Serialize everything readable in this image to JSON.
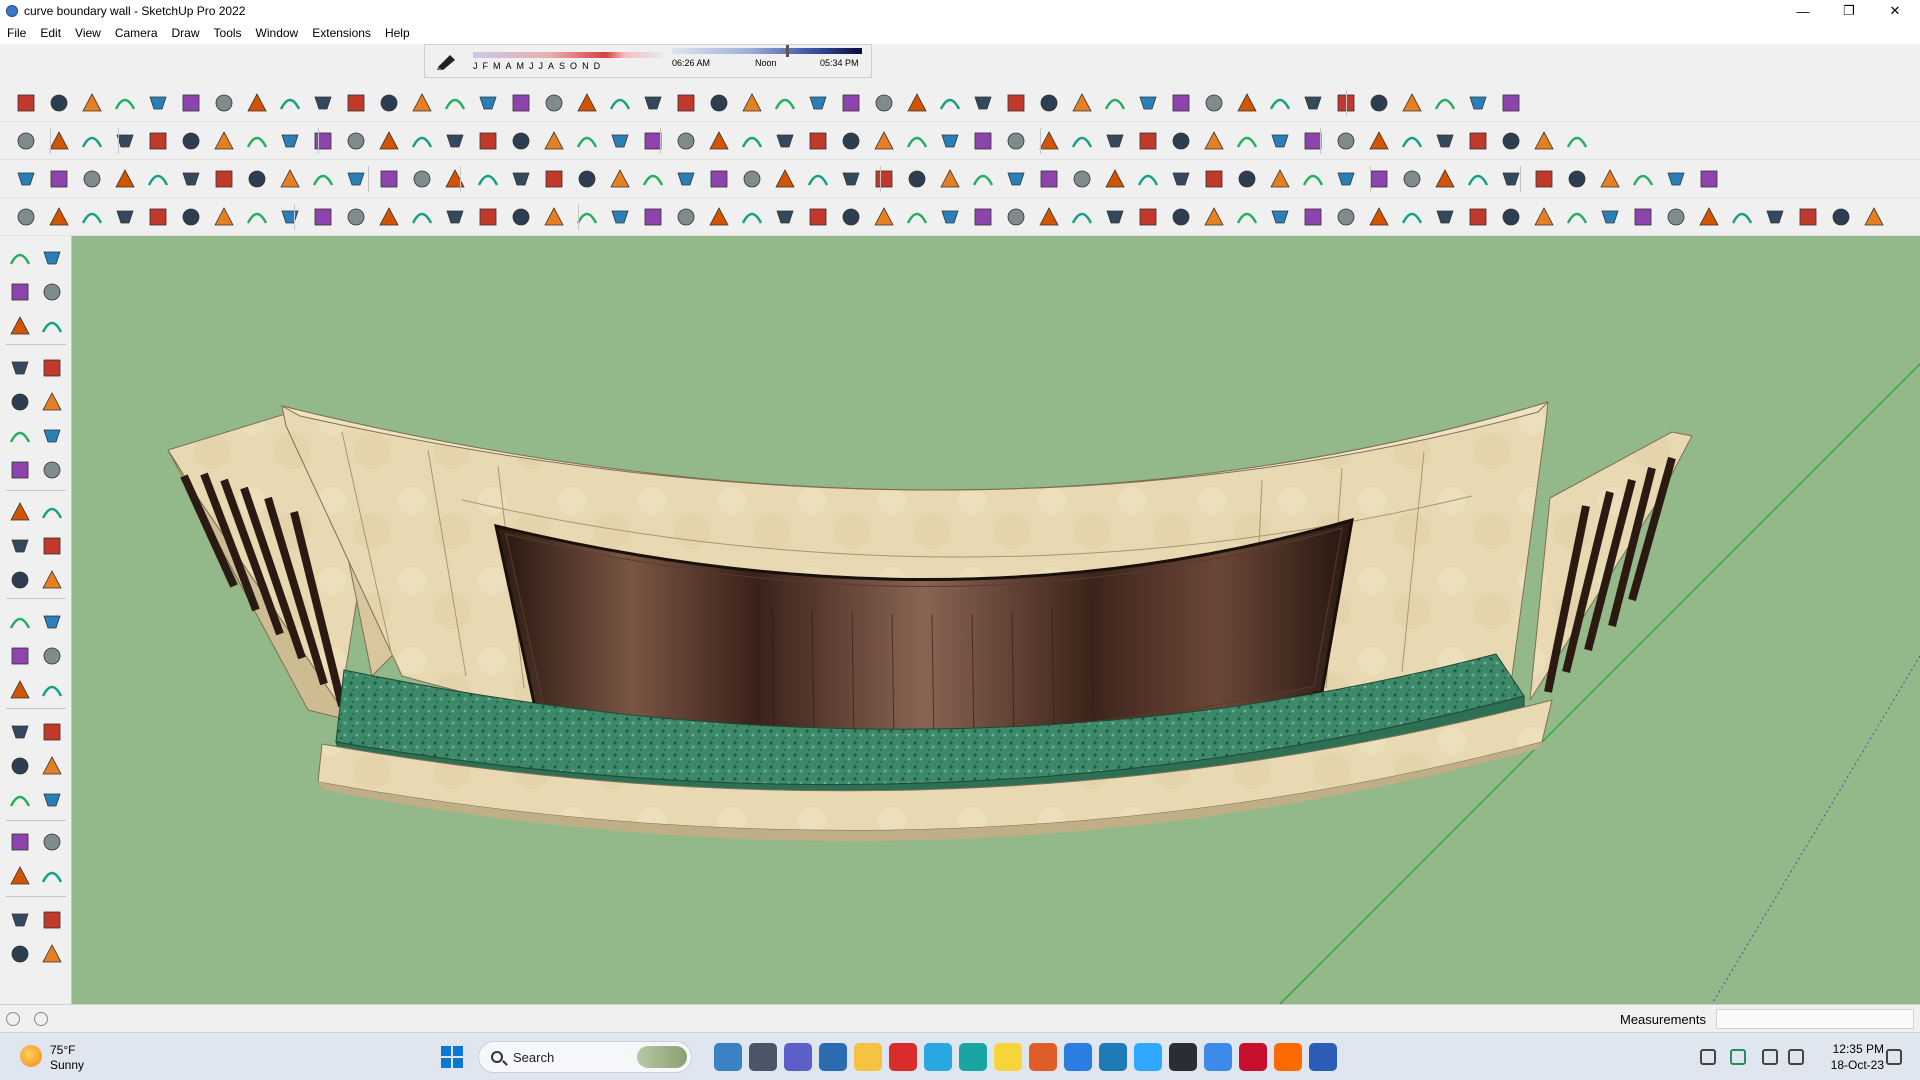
{
  "window": {
    "title": "curve boundary wall - SketchUp Pro 2022",
    "minimize_glyph": "—",
    "maximize_glyph": "❐",
    "close_glyph": "✕"
  },
  "menu": {
    "items": [
      "File",
      "Edit",
      "View",
      "Camera",
      "Draw",
      "Tools",
      "Window",
      "Extensions",
      "Help"
    ]
  },
  "shadow_settings": {
    "months": [
      "J",
      "F",
      "M",
      "A",
      "M",
      "J",
      "J",
      "A",
      "S",
      "O",
      "N",
      "D"
    ],
    "sunrise": "06:26 AM",
    "noon": "Noon",
    "sunset": "05:34 PM"
  },
  "status_bar": {
    "measurements_label": "Measurements",
    "measurements_value": ""
  },
  "taskbar": {
    "temperature": "75°F",
    "condition": "Sunny",
    "search_label": "Search",
    "time": "12:35 PM",
    "date": "18-Oct-23"
  },
  "colors": {
    "viewport_bg": "#93b98a",
    "wall_stone": "#e8d9b3",
    "panel_wood": "#4a2f22",
    "granite": "#3d8a6a"
  }
}
